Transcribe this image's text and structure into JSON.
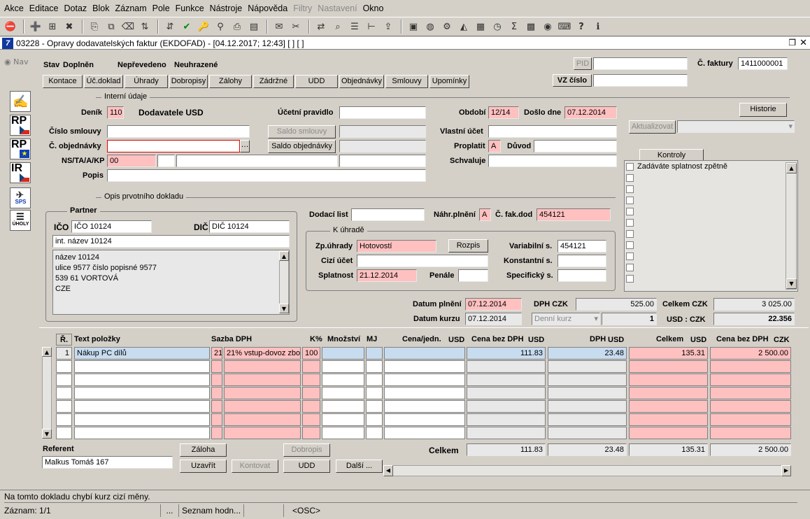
{
  "menu": [
    "Akce",
    "Editace",
    "Dotaz",
    "Blok",
    "Záznam",
    "Pole",
    "Funkce",
    "Nástroje",
    "Nápověda",
    "Filtry",
    "Nastavení",
    "Okno"
  ],
  "toolbar_icons": [
    "exit-icon",
    "add-record-icon",
    "insert-icon",
    "delete-record-icon",
    "copy-icon",
    "copy-record-icon",
    "clear-icon",
    "sort-asc-icon",
    "sort-desc-icon",
    "commit-check-icon",
    "query-icon",
    "filter-icon",
    "print-icon",
    "print-preview-icon",
    "mail-icon",
    "tools-icon",
    "translate-icon",
    "search-icon",
    "list-icon",
    "tree-icon",
    "export-icon",
    "save-icon",
    "globe-icon",
    "settings-icon",
    "chart-icon",
    "calendar-icon",
    "clock-icon",
    "sum-icon",
    "excel-icon",
    "outlook-icon",
    "keyboard-icon",
    "help-icon",
    "info-icon"
  ],
  "window": {
    "title": "03228 - Opravy dodavatelských faktur (EKDOFAD) - [04.12.2017; 12:43]  [ ]  [ ]",
    "logo": "7"
  },
  "nav": "Nav",
  "left_buttons": [
    {
      "label": "",
      "icon": "document-hand-icon"
    },
    {
      "label": "RP",
      "icon": "cz-flag-icon"
    },
    {
      "label": "RP",
      "icon": "eu-flag-icon"
    },
    {
      "label": "IR",
      "icon": "cz-flag-icon"
    },
    {
      "label": "SPS",
      "icon": "plane-icon"
    },
    {
      "label": "ÚHOLY",
      "icon": "list-icon"
    }
  ],
  "status_row": {
    "stav_label": "Stav",
    "stav_value": "Doplněn",
    "state1": "Nepřevedeno",
    "state2": "Neuhrazené"
  },
  "top_right": {
    "pid_label": "PID",
    "pid_value": "",
    "faktura_label": "Č. faktury",
    "faktura_value": "1411000001",
    "vz_label": "VZ číslo",
    "vz_value": ""
  },
  "tabs": [
    "Kontace",
    "Úč.doklad",
    "Úhrady",
    "Dobropisy",
    "Zálohy",
    "Zádržné",
    "UDD",
    "Objednávky",
    "Smlouvy",
    "Upomínky"
  ],
  "interni": {
    "section": "Interní údaje",
    "denik_label": "Deník",
    "denik_value": "110",
    "denik_name": "Dodavatele USD",
    "ucetni_label": "Účetní pravidlo",
    "ucetni_value": "",
    "obdobi_label": "Období",
    "obdobi_value": "12/14",
    "doslo_label": "Došlo dne",
    "doslo_value": "07.12.2014",
    "historie": "Historie",
    "smlouva_label": "Číslo smlouvy",
    "smlouva_value": "",
    "saldo_smlouvy": "Saldo smlouvy",
    "saldo_smlouvy_value": "",
    "vlastni_label": "Vlastní účet",
    "vlastni_value": "",
    "aktualizovat": "Aktualizovat",
    "aktualizovat_value": "",
    "objednavka_label": "Č. objednávky",
    "objednavka_value": "",
    "saldo_obj": "Saldo objednávky",
    "saldo_obj_value": "",
    "proplatit_label": "Proplatit",
    "proplatit_value": "A",
    "duvod_label": "Důvod",
    "duvod_value": "",
    "ns_label": "NS/TA/A/KP",
    "ns1": "00",
    "ns2": "",
    "ns3": "",
    "ns4": "",
    "schvaluje_label": "Schvaluje",
    "schvaluje_value": "",
    "popis_label": "Popis",
    "popis_value": ""
  },
  "kontroly": {
    "button": "Kontroly",
    "items": [
      "Zadáváte splatnost zpětně",
      "",
      "",
      "",
      "",
      "",
      "",
      "",
      "",
      "",
      ""
    ]
  },
  "opis": {
    "section": "Opis prvotního dokladu"
  },
  "partner": {
    "title": "Partner",
    "ico_label": "IČO",
    "ico_value": "IČO 10124",
    "dic_label": "DIČ",
    "dic_value": "DIČ 10124",
    "int_name": "int. název 10124",
    "address": [
      "název 10124",
      "ulice 9577 číslo popisné 9577",
      "539 61 VORTOVÁ",
      "CZE"
    ]
  },
  "doklad": {
    "dodaci_label": "Dodací list",
    "dodaci_value": "",
    "nahr_label": "Náhr.plnění",
    "nahr_value": "A",
    "cfak_label": "Č. fak.dod",
    "cfak_value": "454121"
  },
  "uhrada": {
    "title": "K úhradě",
    "zp_label": "Zp.úhrady",
    "zp_value": "Hotovostí",
    "rozpis": "Rozpis",
    "var_label": "Variabilní s.",
    "var_value": "454121",
    "cizi_label": "Cizí účet",
    "cizi_value": "",
    "konst_label": "Konstantní s.",
    "konst_value": "",
    "splat_label": "Splatnost",
    "splat_value": "21.12.2014",
    "penale_label": "Penále",
    "penale_value": "",
    "spec_label": "Specifický s.",
    "spec_value": ""
  },
  "totals": {
    "plneni_label": "Datum plnění",
    "plneni_value": "07.12.2014",
    "kurzu_label": "Datum kurzu",
    "kurzu_value": "07.12.2014",
    "kurz_type": "Denní kurz",
    "dph_label": "DPH CZK",
    "dph_value": "525.00",
    "kurz_qty": "1",
    "celkem_label": "Celkem CZK",
    "celkem_value": "3 025.00",
    "rate_label": "USD : CZK",
    "rate_value": "22.356"
  },
  "table": {
    "headers": {
      "r": "Ř.",
      "text": "Text položky",
      "sazba": "Sazba DPH",
      "k": "K%",
      "mnozstvi": "Množství",
      "mj": "MJ",
      "cena_jedn": "Cena/jedn.",
      "usd1": "USD",
      "bez_dph": "Cena bez DPH",
      "usd2": "USD",
      "dph": "DPH",
      "usd3": "USD",
      "celkem": "Celkem",
      "usd4": "USD",
      "bez_dph_czk": "Cena bez DPH",
      "czk": "CZK"
    },
    "rows": [
      {
        "r": "1",
        "text": "Nákup PC dílů",
        "sazba": "21",
        "sazba_text": "21% vstup-dovoz zbo",
        "k": "100",
        "mnozstvi": "",
        "mj": "",
        "cena_jedn": "",
        "bez_dph": "111.83",
        "dph": "23.48",
        "celkem": "135.31",
        "czk": "2 500.00"
      },
      {
        "r": "",
        "text": "",
        "sazba": "",
        "sazba_text": "",
        "k": "",
        "mnozstvi": "",
        "mj": "",
        "cena_jedn": "",
        "bez_dph": "",
        "dph": "",
        "celkem": "",
        "czk": ""
      },
      {
        "r": "",
        "text": "",
        "sazba": "",
        "sazba_text": "",
        "k": "",
        "mnozstvi": "",
        "mj": "",
        "cena_jedn": "",
        "bez_dph": "",
        "dph": "",
        "celkem": "",
        "czk": ""
      },
      {
        "r": "",
        "text": "",
        "sazba": "",
        "sazba_text": "",
        "k": "",
        "mnozstvi": "",
        "mj": "",
        "cena_jedn": "",
        "bez_dph": "",
        "dph": "",
        "celkem": "",
        "czk": ""
      },
      {
        "r": "",
        "text": "",
        "sazba": "",
        "sazba_text": "",
        "k": "",
        "mnozstvi": "",
        "mj": "",
        "cena_jedn": "",
        "bez_dph": "",
        "dph": "",
        "celkem": "",
        "czk": ""
      },
      {
        "r": "",
        "text": "",
        "sazba": "",
        "sazba_text": "",
        "k": "",
        "mnozstvi": "",
        "mj": "",
        "cena_jedn": "",
        "bez_dph": "",
        "dph": "",
        "celkem": "",
        "czk": ""
      },
      {
        "r": "",
        "text": "",
        "sazba": "",
        "sazba_text": "",
        "k": "",
        "mnozstvi": "",
        "mj": "",
        "cena_jedn": "",
        "bez_dph": "",
        "dph": "",
        "celkem": "",
        "czk": ""
      }
    ]
  },
  "footer": {
    "referent_label": "Referent",
    "referent_value": "Malkus Tomáš 167",
    "zaloha": "Záloha",
    "dobropis": "Dobropis",
    "uzavrit": "Uzavřít",
    "kontovat": "Kontovat",
    "udd": "UDD",
    "dalsi": "Další ...",
    "celkem_label": "Celkem",
    "sum_bez": "111.83",
    "sum_dph": "23.48",
    "sum_celkem": "135.31",
    "sum_czk": "2 500.00"
  },
  "status": {
    "message": "Na tomto dokladu chybí kurz cizí měny.",
    "record": "Záznam: 1/1",
    "seg2": "...",
    "seg3": "Seznam hodn...",
    "seg4": "",
    "seg5": "<OSC>"
  }
}
